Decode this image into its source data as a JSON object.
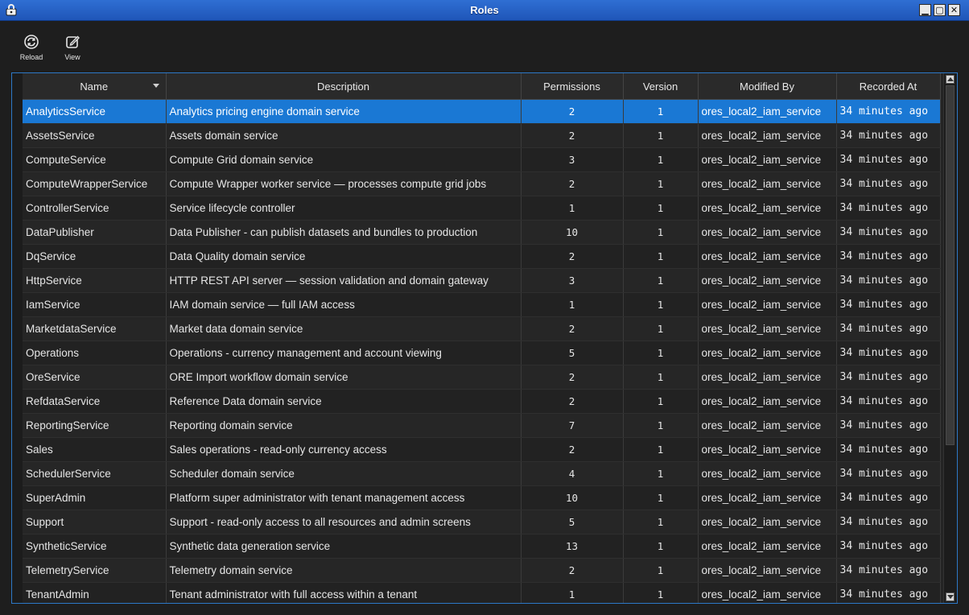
{
  "window": {
    "title": "Roles",
    "controls": {
      "minimize": "▁",
      "maximize": "▢",
      "close": "✕"
    }
  },
  "toolbar": {
    "reload_label": "Reload",
    "view_label": "View"
  },
  "table": {
    "columns": [
      "Name",
      "Description",
      "Permissions",
      "Version",
      "Modified By",
      "Recorded At"
    ],
    "sort_column": "Name",
    "rows": [
      {
        "name": "AnalyticsService",
        "description": "Analytics pricing engine domain service",
        "permissions": "2",
        "version": "1",
        "modified_by": "ores_local2_iam_service",
        "recorded_at": "34 minutes ago"
      },
      {
        "name": "AssetsService",
        "description": "Assets domain service",
        "permissions": "2",
        "version": "1",
        "modified_by": "ores_local2_iam_service",
        "recorded_at": "34 minutes ago"
      },
      {
        "name": "ComputeService",
        "description": "Compute Grid domain service",
        "permissions": "3",
        "version": "1",
        "modified_by": "ores_local2_iam_service",
        "recorded_at": "34 minutes ago"
      },
      {
        "name": "ComputeWrapperService",
        "description": "Compute Wrapper worker service — processes compute grid jobs",
        "permissions": "2",
        "version": "1",
        "modified_by": "ores_local2_iam_service",
        "recorded_at": "34 minutes ago"
      },
      {
        "name": "ControllerService",
        "description": "Service lifecycle controller",
        "permissions": "1",
        "version": "1",
        "modified_by": "ores_local2_iam_service",
        "recorded_at": "34 minutes ago"
      },
      {
        "name": "DataPublisher",
        "description": "Data Publisher - can publish datasets and bundles to production",
        "permissions": "10",
        "version": "1",
        "modified_by": "ores_local2_iam_service",
        "recorded_at": "34 minutes ago"
      },
      {
        "name": "DqService",
        "description": "Data Quality domain service",
        "permissions": "2",
        "version": "1",
        "modified_by": "ores_local2_iam_service",
        "recorded_at": "34 minutes ago"
      },
      {
        "name": "HttpService",
        "description": "HTTP REST API server — session validation and domain gateway",
        "permissions": "3",
        "version": "1",
        "modified_by": "ores_local2_iam_service",
        "recorded_at": "34 minutes ago"
      },
      {
        "name": "IamService",
        "description": "IAM domain service — full IAM access",
        "permissions": "1",
        "version": "1",
        "modified_by": "ores_local2_iam_service",
        "recorded_at": "34 minutes ago"
      },
      {
        "name": "MarketdataService",
        "description": "Market data domain service",
        "permissions": "2",
        "version": "1",
        "modified_by": "ores_local2_iam_service",
        "recorded_at": "34 minutes ago"
      },
      {
        "name": "Operations",
        "description": "Operations - currency management and account viewing",
        "permissions": "5",
        "version": "1",
        "modified_by": "ores_local2_iam_service",
        "recorded_at": "34 minutes ago"
      },
      {
        "name": "OreService",
        "description": "ORE Import workflow domain service",
        "permissions": "2",
        "version": "1",
        "modified_by": "ores_local2_iam_service",
        "recorded_at": "34 minutes ago"
      },
      {
        "name": "RefdataService",
        "description": "Reference Data domain service",
        "permissions": "2",
        "version": "1",
        "modified_by": "ores_local2_iam_service",
        "recorded_at": "34 minutes ago"
      },
      {
        "name": "ReportingService",
        "description": "Reporting domain service",
        "permissions": "7",
        "version": "1",
        "modified_by": "ores_local2_iam_service",
        "recorded_at": "34 minutes ago"
      },
      {
        "name": "Sales",
        "description": "Sales operations - read-only currency access",
        "permissions": "2",
        "version": "1",
        "modified_by": "ores_local2_iam_service",
        "recorded_at": "34 minutes ago"
      },
      {
        "name": "SchedulerService",
        "description": "Scheduler domain service",
        "permissions": "4",
        "version": "1",
        "modified_by": "ores_local2_iam_service",
        "recorded_at": "34 minutes ago"
      },
      {
        "name": "SuperAdmin",
        "description": "Platform super administrator with tenant management access",
        "permissions": "10",
        "version": "1",
        "modified_by": "ores_local2_iam_service",
        "recorded_at": "34 minutes ago"
      },
      {
        "name": "Support",
        "description": "Support - read-only access to all resources and admin screens",
        "permissions": "5",
        "version": "1",
        "modified_by": "ores_local2_iam_service",
        "recorded_at": "34 minutes ago"
      },
      {
        "name": "SyntheticService",
        "description": "Synthetic data generation service",
        "permissions": "13",
        "version": "1",
        "modified_by": "ores_local2_iam_service",
        "recorded_at": "34 minutes ago"
      },
      {
        "name": "TelemetryService",
        "description": "Telemetry domain service",
        "permissions": "2",
        "version": "1",
        "modified_by": "ores_local2_iam_service",
        "recorded_at": "34 minutes ago"
      },
      {
        "name": "TenantAdmin",
        "description": "Tenant administrator with full access within a tenant",
        "permissions": "1",
        "version": "1",
        "modified_by": "ores_local2_iam_service",
        "recorded_at": "34 minutes ago"
      }
    ],
    "selected_row": "AnalyticsService"
  },
  "colors": {
    "titlebar": "#2563c7",
    "selection": "#1a78d4",
    "frame_border": "#2d78c7",
    "background": "#1e1e1e"
  },
  "icons": {
    "title": "lock-icon",
    "reload": "reload-icon",
    "view": "edit-icon"
  }
}
